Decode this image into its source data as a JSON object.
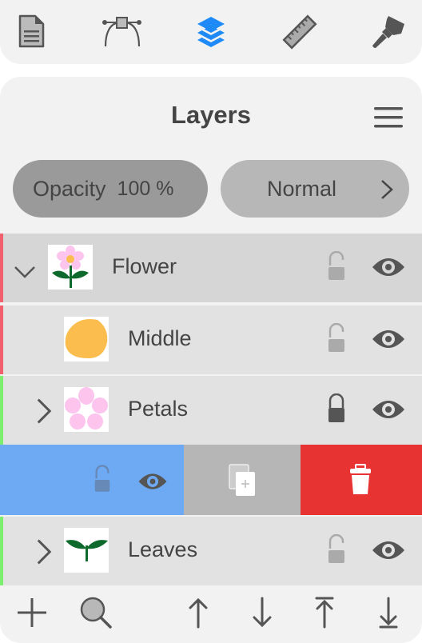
{
  "toolbar": {
    "items": [
      {
        "icon": "document-icon",
        "active": false
      },
      {
        "icon": "bezier-path-icon",
        "active": false
      },
      {
        "icon": "layers-icon",
        "active": true
      },
      {
        "icon": "ruler-icon",
        "active": false
      },
      {
        "icon": "paintbrush-icon",
        "active": false
      }
    ],
    "active_color": "#1e8af7",
    "icon_color": "#555555"
  },
  "panel": {
    "title": "Layers",
    "menu_icon": "hamburger-menu-icon",
    "opacity": {
      "label": "Opacity",
      "value": "100 %"
    },
    "blend_mode": {
      "value": "Normal",
      "icon": "chevron-right-icon"
    }
  },
  "layers": [
    {
      "name": "Flower",
      "expanded": true,
      "depth": 0,
      "locked": false,
      "visible": true,
      "tag_color": "#f2606e",
      "thumbnail": "flower"
    },
    {
      "name": "Middle",
      "expanded": null,
      "depth": 1,
      "locked": false,
      "visible": true,
      "tag_color": "#f2606e",
      "thumbnail": "yellow-circle"
    },
    {
      "name": "Petals",
      "expanded": false,
      "depth": 1,
      "locked": true,
      "visible": true,
      "tag_color": "#7cf06e",
      "thumbnail": "petals"
    },
    {
      "name": "Leaves",
      "expanded": false,
      "depth": 1,
      "locked": false,
      "visible": true,
      "tag_color": "#7cf06e",
      "thumbnail": "leaves"
    }
  ],
  "swipe_actions": {
    "toggle_color": "#6eaaf3",
    "duplicate_color": "#b6b6b6",
    "delete_color": "#e83333",
    "actions": [
      "lock",
      "visibility",
      "duplicate",
      "delete"
    ]
  },
  "bottom_bar": {
    "buttons": [
      "add-layer",
      "search",
      "move-up",
      "move-down",
      "move-to-top",
      "move-to-bottom"
    ]
  }
}
